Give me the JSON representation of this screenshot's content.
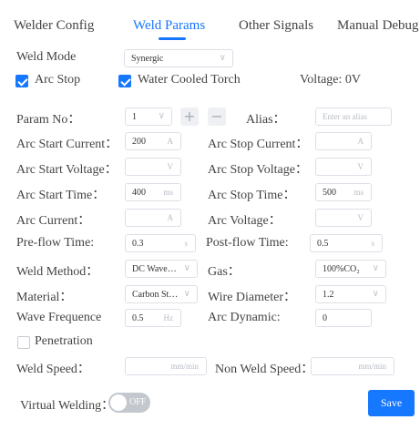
{
  "tabs": [
    {
      "label": "Welder Config"
    },
    {
      "label": "Weld Params"
    },
    {
      "label": "Other Signals"
    },
    {
      "label": "Manual Debug"
    }
  ],
  "weld_mode": {
    "label": "Weld Mode",
    "value": "Synergic"
  },
  "arc_stop": {
    "label": "Arc Stop",
    "checked": true
  },
  "water_cooled": {
    "label": "Water Cooled Torch",
    "checked": true
  },
  "voltage": {
    "text": "Voltage: 0V"
  },
  "param_no": {
    "label": "Param No：",
    "value": "1"
  },
  "alias": {
    "label": "Alias：",
    "placeholder": "Enter an alias"
  },
  "arc_start_current": {
    "label": "Arc Start Current：",
    "value": "200",
    "unit": "A"
  },
  "arc_stop_current": {
    "label": "Arc Stop Current：",
    "value": "",
    "unit": "A"
  },
  "arc_start_voltage": {
    "label": "Arc Start Voltage：",
    "value": "",
    "unit": "V"
  },
  "arc_stop_voltage": {
    "label": "Arc Stop Voltage：",
    "value": "",
    "unit": "V"
  },
  "arc_start_time": {
    "label": "Arc Start Time：",
    "value": "400",
    "unit": "ms"
  },
  "arc_stop_time": {
    "label": "Arc Stop Time：",
    "value": "500",
    "unit": "ms"
  },
  "arc_current": {
    "label": "Arc Current：",
    "value": "",
    "unit": "A"
  },
  "arc_voltage": {
    "label": "Arc Voltage：",
    "value": "",
    "unit": "V"
  },
  "pre_flow_time": {
    "label": "Pre-flow Time:",
    "value": "0.3",
    "unit": "s"
  },
  "post_flow_time": {
    "label": "Post-flow Time:",
    "value": "0.5",
    "unit": "s"
  },
  "weld_method": {
    "label": "Weld Method：",
    "value": "DC Wave…"
  },
  "gas": {
    "label": "Gas：",
    "value": "100%CO₂"
  },
  "material": {
    "label": "Material：",
    "value": "Carbon St…"
  },
  "wire_diameter": {
    "label": "Wire Diameter：",
    "value": "1.2"
  },
  "wave_frequence": {
    "label": "Wave Frequence",
    "value": "0.5",
    "unit": "Hz"
  },
  "arc_dynamic": {
    "label": "Arc Dynamic:",
    "value": "0"
  },
  "penetration": {
    "label": "Penetration",
    "checked": false
  },
  "weld_speed": {
    "label": "Weld Speed：",
    "value": "",
    "unit": "mm/min"
  },
  "non_weld_speed": {
    "label": "Non Weld Speed：",
    "value": "",
    "unit": "mm/min"
  },
  "virtual_welding": {
    "label": "Virtual Welding：",
    "state": "OFF"
  },
  "save": {
    "label": "Save"
  },
  "icons": {
    "chevron": "chevron-down-icon",
    "plus": "plus-icon",
    "minus": "minus-icon",
    "check": "check-icon"
  },
  "colors": {
    "accent": "#1677ff",
    "toggle_off": "#c3c7ce",
    "input_border": "#dcdfe6"
  }
}
